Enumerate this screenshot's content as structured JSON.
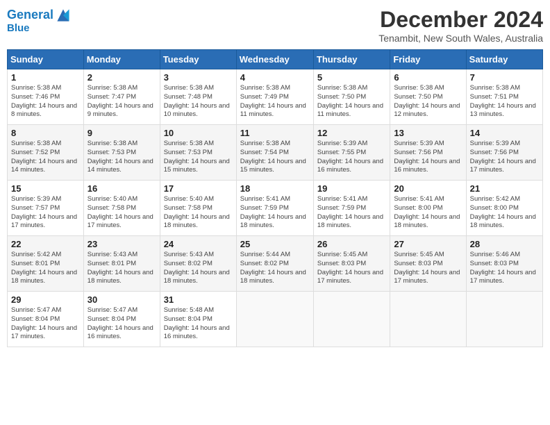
{
  "header": {
    "logo_line1": "General",
    "logo_line2": "Blue",
    "month_title": "December 2024",
    "location": "Tenambit, New South Wales, Australia"
  },
  "weekdays": [
    "Sunday",
    "Monday",
    "Tuesday",
    "Wednesday",
    "Thursday",
    "Friday",
    "Saturday"
  ],
  "weeks": [
    [
      {
        "day": 1,
        "sunrise": "5:38 AM",
        "sunset": "7:46 PM",
        "daylight": "14 hours and 8 minutes."
      },
      {
        "day": 2,
        "sunrise": "5:38 AM",
        "sunset": "7:47 PM",
        "daylight": "14 hours and 9 minutes."
      },
      {
        "day": 3,
        "sunrise": "5:38 AM",
        "sunset": "7:48 PM",
        "daylight": "14 hours and 10 minutes."
      },
      {
        "day": 4,
        "sunrise": "5:38 AM",
        "sunset": "7:49 PM",
        "daylight": "14 hours and 11 minutes."
      },
      {
        "day": 5,
        "sunrise": "5:38 AM",
        "sunset": "7:50 PM",
        "daylight": "14 hours and 11 minutes."
      },
      {
        "day": 6,
        "sunrise": "5:38 AM",
        "sunset": "7:50 PM",
        "daylight": "14 hours and 12 minutes."
      },
      {
        "day": 7,
        "sunrise": "5:38 AM",
        "sunset": "7:51 PM",
        "daylight": "14 hours and 13 minutes."
      }
    ],
    [
      {
        "day": 8,
        "sunrise": "5:38 AM",
        "sunset": "7:52 PM",
        "daylight": "14 hours and 14 minutes."
      },
      {
        "day": 9,
        "sunrise": "5:38 AM",
        "sunset": "7:53 PM",
        "daylight": "14 hours and 14 minutes."
      },
      {
        "day": 10,
        "sunrise": "5:38 AM",
        "sunset": "7:53 PM",
        "daylight": "14 hours and 15 minutes."
      },
      {
        "day": 11,
        "sunrise": "5:38 AM",
        "sunset": "7:54 PM",
        "daylight": "14 hours and 15 minutes."
      },
      {
        "day": 12,
        "sunrise": "5:39 AM",
        "sunset": "7:55 PM",
        "daylight": "14 hours and 16 minutes."
      },
      {
        "day": 13,
        "sunrise": "5:39 AM",
        "sunset": "7:56 PM",
        "daylight": "14 hours and 16 minutes."
      },
      {
        "day": 14,
        "sunrise": "5:39 AM",
        "sunset": "7:56 PM",
        "daylight": "14 hours and 17 minutes."
      }
    ],
    [
      {
        "day": 15,
        "sunrise": "5:39 AM",
        "sunset": "7:57 PM",
        "daylight": "14 hours and 17 minutes."
      },
      {
        "day": 16,
        "sunrise": "5:40 AM",
        "sunset": "7:58 PM",
        "daylight": "14 hours and 17 minutes."
      },
      {
        "day": 17,
        "sunrise": "5:40 AM",
        "sunset": "7:58 PM",
        "daylight": "14 hours and 18 minutes."
      },
      {
        "day": 18,
        "sunrise": "5:41 AM",
        "sunset": "7:59 PM",
        "daylight": "14 hours and 18 minutes."
      },
      {
        "day": 19,
        "sunrise": "5:41 AM",
        "sunset": "7:59 PM",
        "daylight": "14 hours and 18 minutes."
      },
      {
        "day": 20,
        "sunrise": "5:41 AM",
        "sunset": "8:00 PM",
        "daylight": "14 hours and 18 minutes."
      },
      {
        "day": 21,
        "sunrise": "5:42 AM",
        "sunset": "8:00 PM",
        "daylight": "14 hours and 18 minutes."
      }
    ],
    [
      {
        "day": 22,
        "sunrise": "5:42 AM",
        "sunset": "8:01 PM",
        "daylight": "14 hours and 18 minutes."
      },
      {
        "day": 23,
        "sunrise": "5:43 AM",
        "sunset": "8:01 PM",
        "daylight": "14 hours and 18 minutes."
      },
      {
        "day": 24,
        "sunrise": "5:43 AM",
        "sunset": "8:02 PM",
        "daylight": "14 hours and 18 minutes."
      },
      {
        "day": 25,
        "sunrise": "5:44 AM",
        "sunset": "8:02 PM",
        "daylight": "14 hours and 18 minutes."
      },
      {
        "day": 26,
        "sunrise": "5:45 AM",
        "sunset": "8:03 PM",
        "daylight": "14 hours and 17 minutes."
      },
      {
        "day": 27,
        "sunrise": "5:45 AM",
        "sunset": "8:03 PM",
        "daylight": "14 hours and 17 minutes."
      },
      {
        "day": 28,
        "sunrise": "5:46 AM",
        "sunset": "8:03 PM",
        "daylight": "14 hours and 17 minutes."
      }
    ],
    [
      {
        "day": 29,
        "sunrise": "5:47 AM",
        "sunset": "8:04 PM",
        "daylight": "14 hours and 17 minutes."
      },
      {
        "day": 30,
        "sunrise": "5:47 AM",
        "sunset": "8:04 PM",
        "daylight": "14 hours and 16 minutes."
      },
      {
        "day": 31,
        "sunrise": "5:48 AM",
        "sunset": "8:04 PM",
        "daylight": "14 hours and 16 minutes."
      },
      null,
      null,
      null,
      null
    ]
  ]
}
